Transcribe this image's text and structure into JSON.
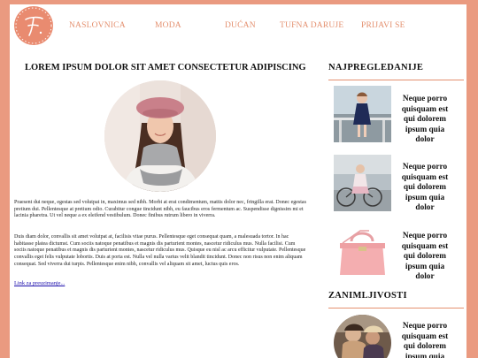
{
  "nav": {
    "items": [
      "NASLOVNICA",
      "MODA",
      "DUĆAN",
      "TUFNA DARUJE",
      "PRIJAVI SE"
    ]
  },
  "article": {
    "title": "LOREM IPSUM DOLOR SIT AMET CONSECTETUR ADIPISCING",
    "paragraph1": "Praesent dui neque, egestas sed volutpat in, maximus sed nibh. Morbi at erat condimentum, mattis dolor nec, fringilla erat. Donec egestas pretium dui. Pellentesque at pretium odio. Curabitur congue tincidunt nibh, eu faucibus eros fermentum ac. Suspendisse dignissim mi et lacinia pharetra. Ut vel neque a ex eleifend vestibulum. Donec finibus rutrum libero in viverra.",
    "paragraph2": "Duis diam dolor, convallis sit amet volutpat at, facilisis vitae purus. Pellentesque eget consequat quam, a malesuada tortor. In hac habitasse platea dictumst. Cum sociis natoque penatibus et magnis dis parturient montes, nascetur ridiculus mus. Nulla facilisi. Cum sociis natoque penatibus et magnis dis parturient montes, nascetur ridiculus mus. Quisque eu nisl ac arcu efficitur vulputate. Pellentesque convallis eget felis vulputate lobortis. Duis at porta est. Nulla vel nulla varius velit blandit tincidunt. Donec non risus non enim aliquam consequat. Sed viverra dui turpis. Pellentesque enim nibh, convallis vel aliquam sit amet, luctus quis eros.",
    "link": "Link za preuzimanje..."
  },
  "sidebar": {
    "most_viewed_heading": "NAJPREGLEDANIJE",
    "most_viewed": [
      {
        "text": "Neque porro quisquam est qui dolorem ipsum quia dolor"
      },
      {
        "text": "Neque porro quisquam est qui dolorem ipsum quia dolor"
      },
      {
        "text": "Neque porro quisquam est qui dolorem ipsum quia dolor"
      }
    ],
    "interesting_heading": "ZANIMLJIVOSTI",
    "interesting": [
      {
        "text": "Neque porro quisquam est qui dolorem ipsum quia"
      }
    ]
  },
  "colors": {
    "accent": "#e4906f",
    "background": "#ea9a80"
  }
}
